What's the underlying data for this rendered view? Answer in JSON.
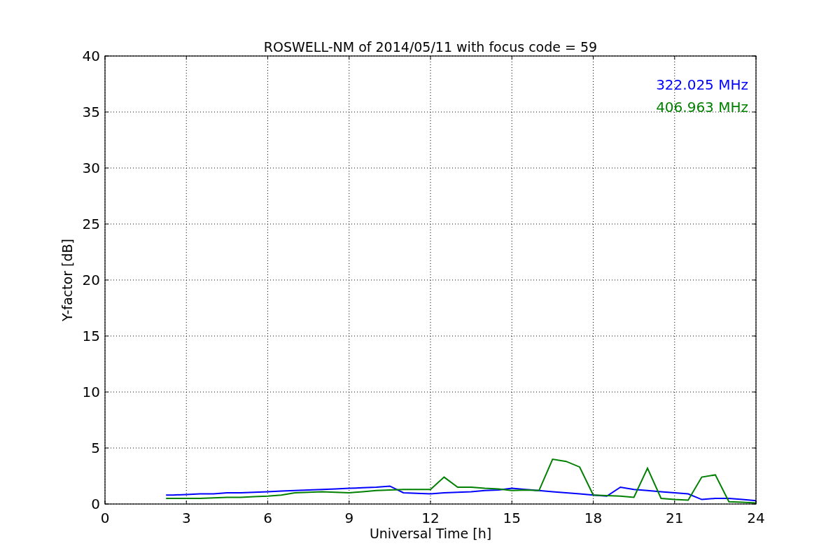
{
  "chart_data": {
    "type": "line",
    "title": "ROSWELL-NM of 2014/05/11 with focus code = 59",
    "xlabel": "Universal Time [h]",
    "ylabel": "Y-factor [dB]",
    "x": [
      2.25,
      2.5,
      3,
      3.5,
      4,
      4.5,
      5,
      5.5,
      6,
      6.5,
      7,
      7.5,
      8,
      8.5,
      9,
      9.5,
      10,
      10.5,
      11,
      11.5,
      12,
      12.5,
      13,
      13.5,
      14,
      14.5,
      15,
      15.5,
      16,
      16.5,
      17,
      17.5,
      18,
      18.5,
      19,
      19.5,
      20,
      20.5,
      21,
      21.5,
      22,
      22.5,
      23,
      23.5,
      24
    ],
    "grid": true,
    "xlim": [
      0,
      24
    ],
    "ylim": [
      0,
      40
    ],
    "xticks": [
      0,
      3,
      6,
      9,
      12,
      15,
      18,
      21,
      24
    ],
    "yticks": [
      0,
      5,
      10,
      15,
      20,
      25,
      30,
      35,
      40
    ],
    "series": [
      {
        "name": "322.025 MHz",
        "color": "#0000ff",
        "values": [
          0.8,
          0.8,
          0.85,
          0.9,
          0.9,
          1.0,
          1.0,
          1.05,
          1.1,
          1.15,
          1.2,
          1.25,
          1.3,
          1.35,
          1.4,
          1.45,
          1.5,
          1.6,
          1.0,
          0.95,
          0.9,
          1.0,
          1.05,
          1.1,
          1.2,
          1.25,
          1.4,
          1.3,
          1.2,
          1.1,
          1.0,
          0.9,
          0.8,
          0.7,
          1.5,
          1.3,
          1.2,
          1.1,
          1.0,
          0.9,
          0.4,
          0.5,
          0.5,
          0.4,
          0.3
        ]
      },
      {
        "name": "406.963 MHz",
        "color": "#008000",
        "values": [
          0.5,
          0.5,
          0.5,
          0.5,
          0.55,
          0.6,
          0.6,
          0.65,
          0.7,
          0.8,
          1.0,
          1.05,
          1.1,
          1.05,
          1.0,
          1.1,
          1.2,
          1.25,
          1.3,
          1.3,
          1.3,
          2.4,
          1.5,
          1.5,
          1.4,
          1.35,
          1.2,
          1.25,
          1.2,
          4.0,
          3.8,
          3.3,
          0.8,
          0.75,
          0.7,
          0.6,
          3.2,
          0.5,
          0.4,
          0.35,
          2.4,
          2.6,
          0.2,
          0.15,
          0.1
        ]
      }
    ]
  }
}
